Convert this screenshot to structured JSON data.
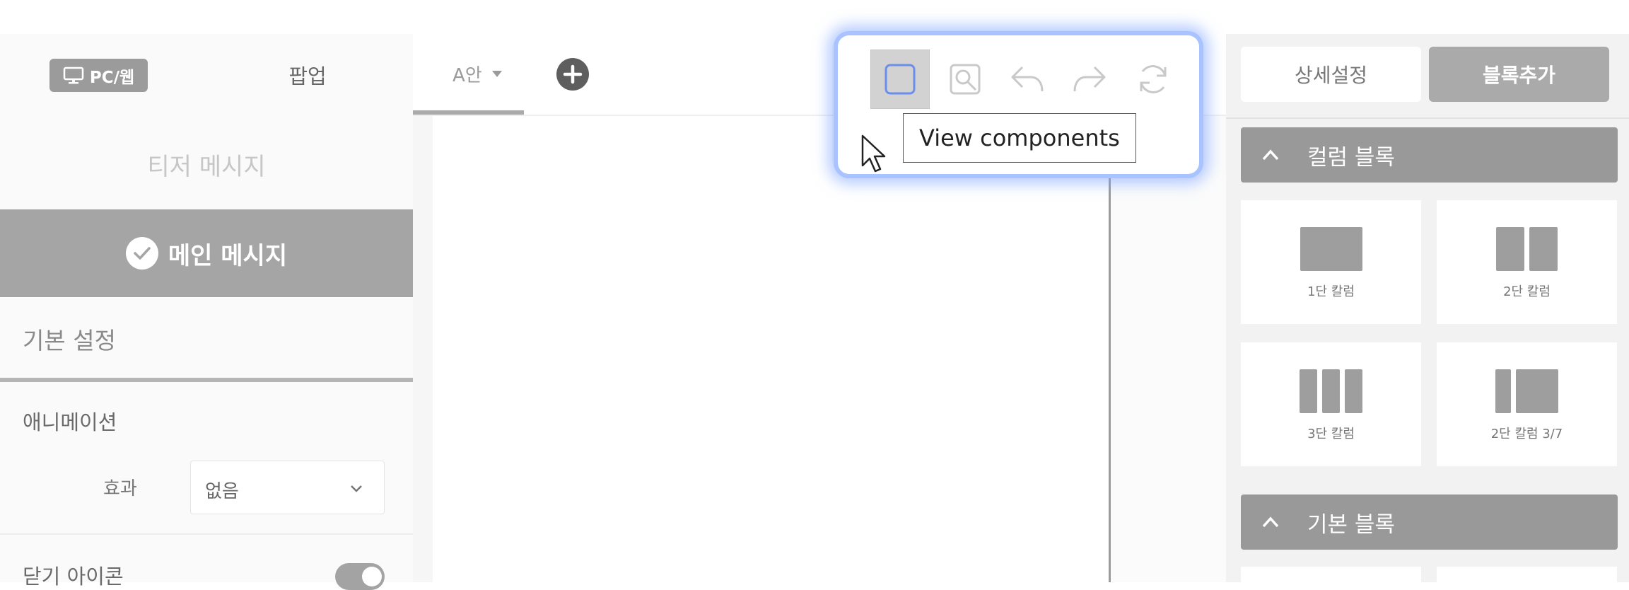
{
  "left_panel": {
    "platform_label": "PC/웹",
    "popup_label": "팝업",
    "teaser_label": "티저 메시지",
    "main_message_label": "메인 메시지",
    "basic_settings_label": "기본 설정",
    "animation_title": "애니메이션",
    "effect_label": "효과",
    "effect_value": "없음",
    "close_icon_label": "닫기 아이콘"
  },
  "center": {
    "variant_label": "A안"
  },
  "toolbar": {
    "tooltip": "View components"
  },
  "right_panel": {
    "tabs": [
      "상세설정",
      "블록추가"
    ],
    "sections": [
      {
        "title": "컬럼 블록",
        "tiles": [
          "1단 칼럼",
          "2단 칼럼",
          "3단 칼럼",
          "2단 칼럼 3/7"
        ]
      },
      {
        "title": "기본 블록"
      }
    ]
  },
  "colors": {
    "toolbar_glow": "#a8c3ff",
    "active_icon": "#6b8fe8",
    "selected_gray": "#a5a5a5"
  },
  "icons": [
    "monitor-icon",
    "check-icon",
    "chevron-down-icon",
    "plus-icon",
    "view-components-icon",
    "zoom-icon",
    "undo-icon",
    "redo-icon",
    "refresh-icon",
    "cursor-icon",
    "chevron-up-icon"
  ]
}
